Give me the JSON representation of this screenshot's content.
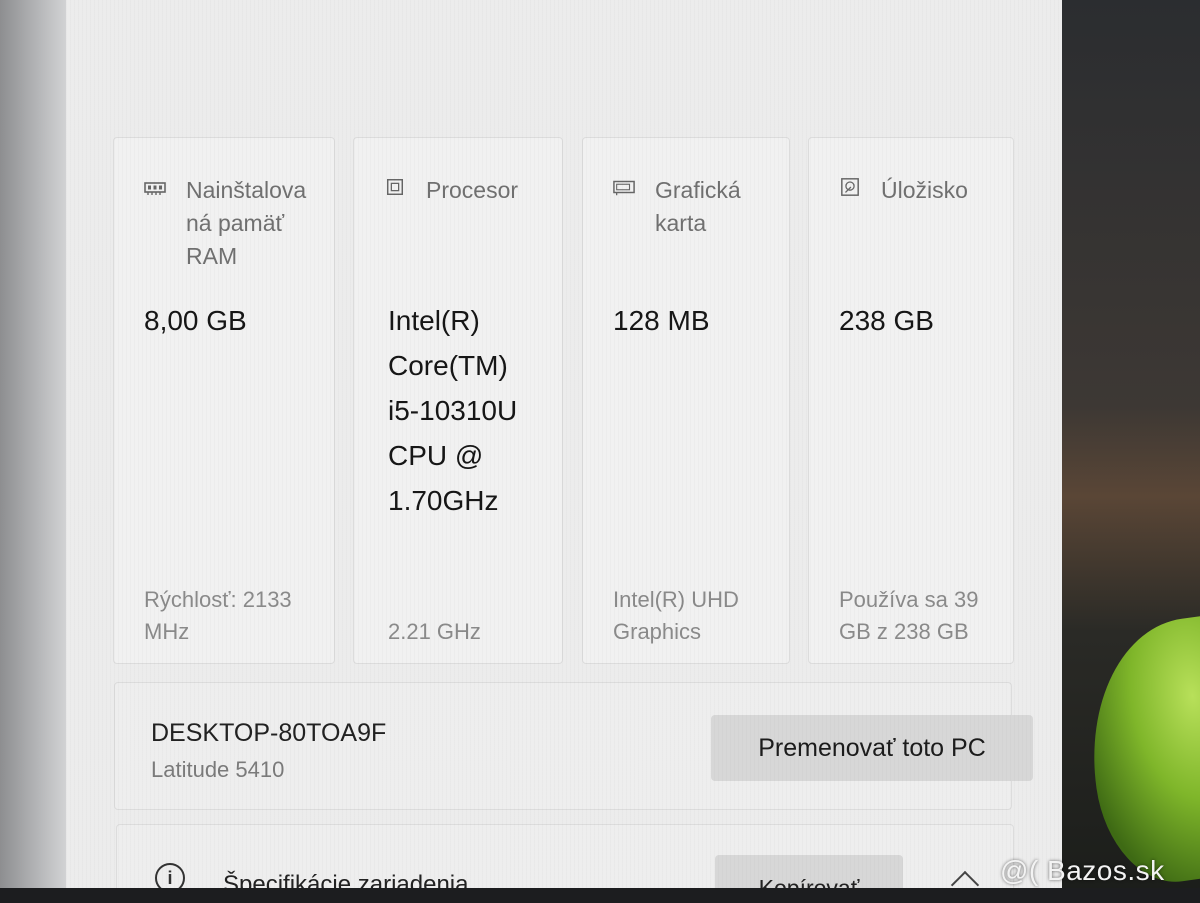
{
  "specs": {
    "ram": {
      "title": "Nainštalovaná pamäť RAM",
      "title_lines": [
        "Nainštalova",
        "ná pamäť",
        "RAM"
      ],
      "value": "8,00 GB",
      "footer": "Rýchlosť: 2133 MHz",
      "footer_lines": [
        "Rýchlosť: 2133",
        "MHz"
      ],
      "icon": "ram-icon"
    },
    "cpu": {
      "title": "Procesor",
      "value": "Intel(R) Core(TM) i5-10310U CPU @ 1.70GHz",
      "value_lines": [
        "Intel(R)",
        "Core(TM)",
        "i5-10310U",
        "CPU @",
        "1.70GHz"
      ],
      "footer": "2.21 GHz",
      "icon": "processor-icon"
    },
    "gpu": {
      "title": "Grafická karta",
      "title_lines": [
        "Grafická",
        "karta"
      ],
      "value": "128 MB",
      "footer": "Intel(R) UHD Graphics",
      "footer_lines": [
        "Intel(R) UHD",
        "Graphics"
      ],
      "icon": "graphics-card-icon"
    },
    "storage": {
      "title": "Úložisko",
      "value": "238 GB",
      "footer": "Používa sa 39 GB z 238 GB",
      "footer_lines": [
        "Používa sa 39",
        "GB z 238 GB"
      ],
      "icon": "storage-icon"
    }
  },
  "device": {
    "name": "DESKTOP-80TOA9F",
    "model": "Latitude 5410",
    "rename_label": "Premenovať toto PC"
  },
  "device_specs": {
    "title": "Špecifikácie zariadenia",
    "copy_label": "Kopírovať"
  },
  "watermark": "@( Bazos.sk"
}
